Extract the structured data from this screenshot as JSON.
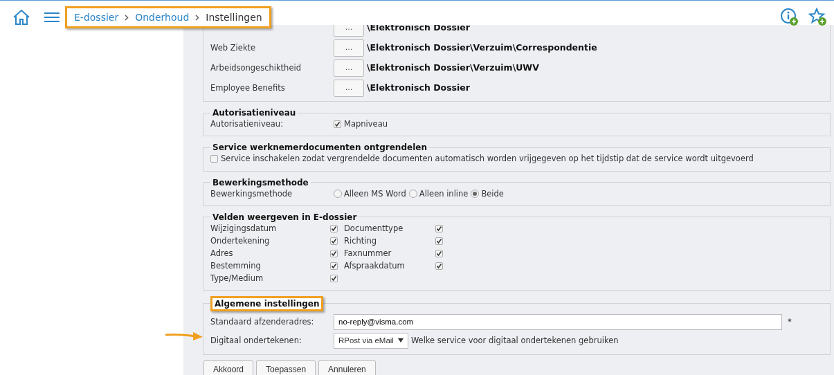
{
  "breadcrumb": [
    {
      "label": "E-dossier",
      "link": true
    },
    {
      "label": "Onderhoud",
      "link": true
    },
    {
      "label": "Instellingen",
      "link": false
    }
  ],
  "folders": {
    "rows": [
      {
        "path": "\\Elektronisch Dossier",
        "button": "..."
      },
      {
        "label": "Web Ziekte",
        "button": "...",
        "path": "\\Elektronisch Dossier\\Verzuim\\Correspondentie"
      },
      {
        "label": "Arbeidsongeschiktheid",
        "button": "...",
        "path": "\\Elektronisch Dossier\\Verzuim\\UWV"
      },
      {
        "label": "Employee Benefits",
        "button": "...",
        "path": "\\Elektronisch Dossier"
      }
    ]
  },
  "authorization": {
    "legend": "Autorisatieniveau",
    "label": "Autorisatieniveau:",
    "option": "Mapniveau",
    "checked": true
  },
  "unlock_service": {
    "legend": "Service werknemerdocumenten ontgrendelen",
    "option": "Service inschakelen zodat vergrendelde documenten automatisch worden vrijgegeven op het tijdstip dat de service wordt uitgevoerd",
    "checked": false
  },
  "edit_method": {
    "legend": "Bewerkingsmethode",
    "label": "Bewerkingsmethode",
    "options": [
      {
        "label": "Alleen MS Word",
        "selected": false
      },
      {
        "label": "Alleen inline",
        "selected": false
      },
      {
        "label": "Beide",
        "selected": true
      }
    ]
  },
  "fields": {
    "legend": "Velden weergeven in E-dossier",
    "items": [
      {
        "label": "Wijzigingsdatum",
        "checked": true
      },
      {
        "label": "Documenttype",
        "checked": true
      },
      {
        "label": "Ondertekening",
        "checked": true
      },
      {
        "label": "Richting",
        "checked": true
      },
      {
        "label": "Adres",
        "checked": true
      },
      {
        "label": "Faxnummer",
        "checked": true
      },
      {
        "label": "Bestemming",
        "checked": true
      },
      {
        "label": "Afspraakdatum",
        "checked": true
      },
      {
        "label": "Type/Medium",
        "checked": true
      }
    ]
  },
  "general": {
    "legend": "Algemene instellingen",
    "sender_label": "Standaard afzenderadres:",
    "sender_value": "no-reply@visma.com",
    "required_mark": "*",
    "sign_label": "Digitaal ondertekenen:",
    "sign_value": "RPost via eMail",
    "sign_hint": "Welke service voor digitaal ondertekenen gebruiken"
  },
  "buttons": [
    "Akkoord",
    "Toepassen",
    "Annuleren"
  ]
}
